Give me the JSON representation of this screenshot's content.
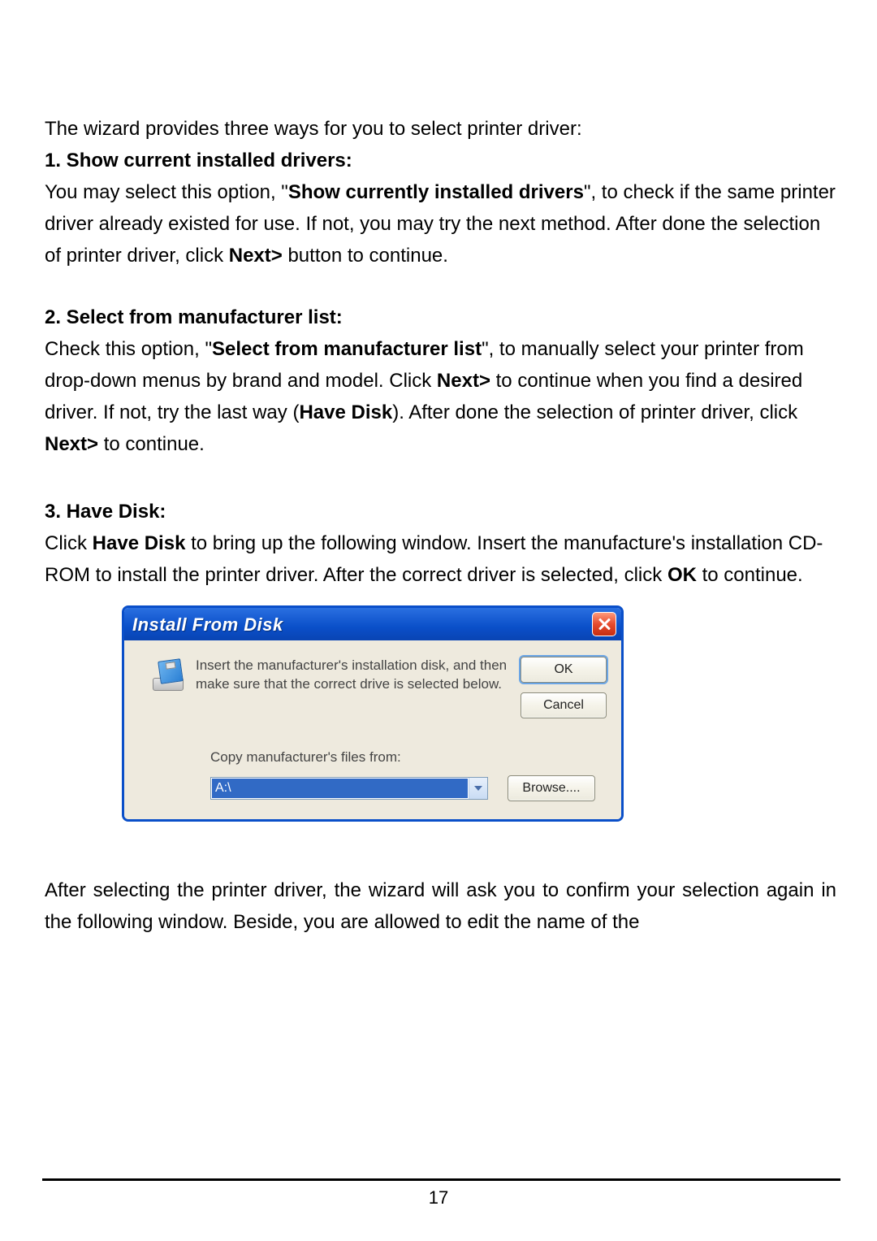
{
  "intro": "The wizard provides three ways for you to select printer driver:",
  "s1": {
    "heading": "1. Show current installed drivers:",
    "p_a": "You may select this option, \"",
    "p_bold": "Show currently installed drivers",
    "p_b": "\", to check if the same printer driver already existed for use. If not, you may try the next method. After done the selection of printer driver, click ",
    "p_bold2": "Next>",
    "p_c": " button to continue."
  },
  "s2": {
    "heading": "2. Select from manufacturer list:",
    "p_a": "Check this option, \"",
    "p_bold1": "Select from manufacturer list",
    "p_b": "\", to manually select your printer from drop-down menus by brand and model. Click ",
    "p_bold2": "Next>",
    "p_c": " to continue when you find a desired driver. If not, try the last way (",
    "p_bold3": "Have Disk",
    "p_d": "). After done the selection of printer driver, click ",
    "p_bold4": "Next>",
    "p_e": " to continue."
  },
  "s3": {
    "heading": "3. Have Disk:",
    "p_a": "Click ",
    "p_bold1": "Have Disk",
    "p_b": " to bring up the following window. Insert the manufacture's installation CD-ROM to install the printer driver. After the correct driver is selected, click ",
    "p_bold2": "OK",
    "p_c": " to continue."
  },
  "dialog": {
    "title": "Install From Disk",
    "message": "Insert the manufacturer's installation disk, and then make sure that the correct drive is selected below.",
    "ok": "OK",
    "cancel": "Cancel",
    "copy_label": "Copy manufacturer's files from:",
    "path": "A:\\",
    "browse": "Browse...."
  },
  "after": "After selecting the printer driver, the wizard will ask you to confirm your selection again in the following window. Beside, you are allowed to edit the name of the",
  "page_number": "17"
}
